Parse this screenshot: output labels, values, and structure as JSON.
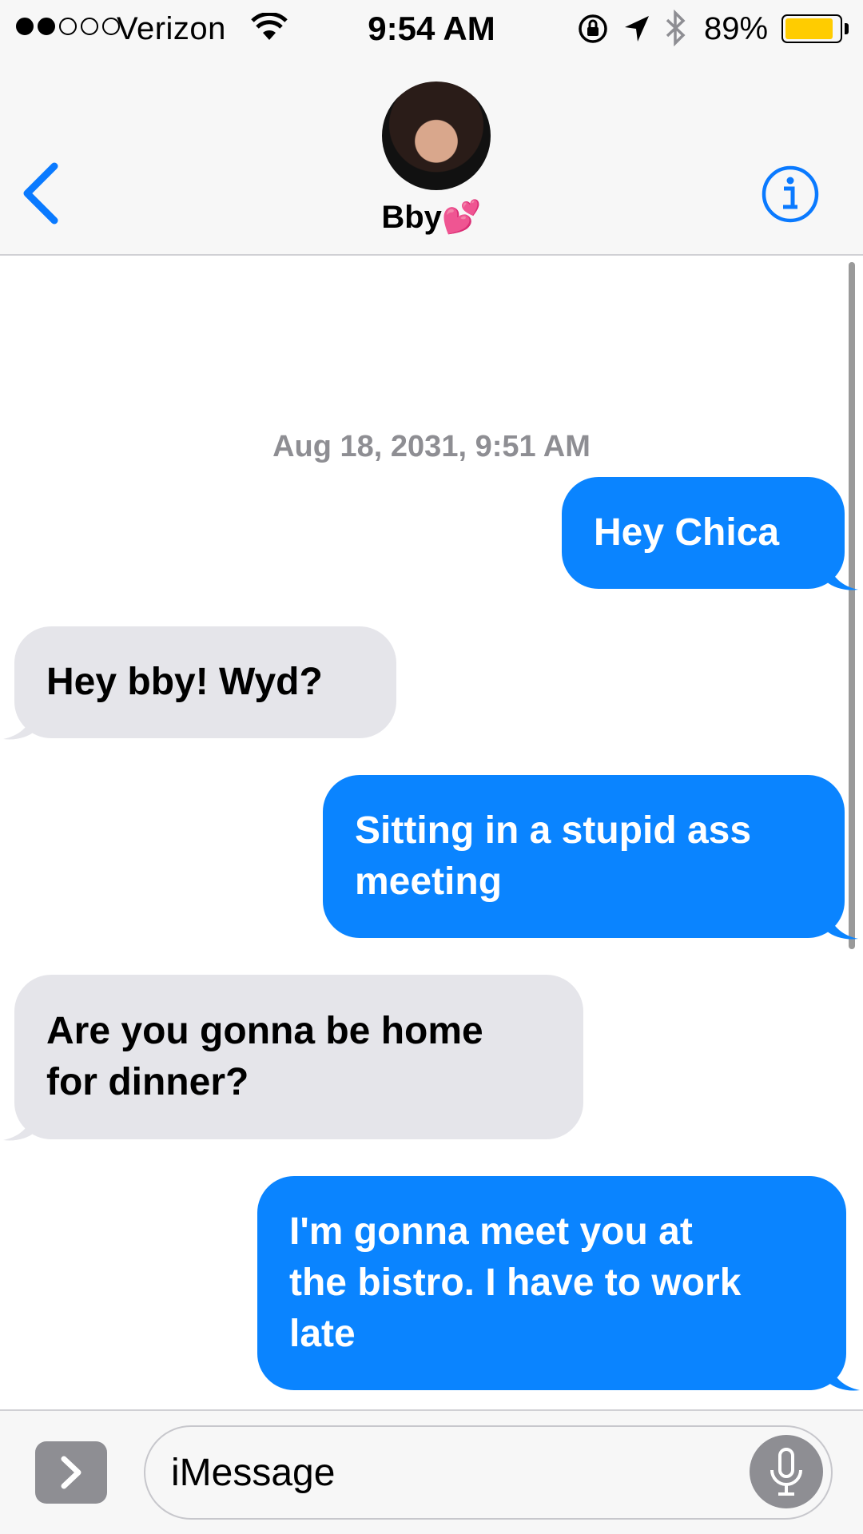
{
  "status_bar": {
    "carrier": "Verizon",
    "time": "9:54 AM",
    "battery_percent": "89%",
    "battery_level": 0.89,
    "signal_bars_filled": 2,
    "signal_bars_total": 5
  },
  "nav": {
    "contact_name": "Bby💕",
    "back_icon": "chevron-left-icon",
    "info_icon": "info-icon"
  },
  "conversation": {
    "timestamp": "Aug 18, 2031, 9:51 AM",
    "messages": [
      {
        "direction": "sent",
        "lines": [
          "Hey Chica"
        ]
      },
      {
        "direction": "received",
        "lines": [
          "Hey bby! Wyd?"
        ]
      },
      {
        "direction": "sent",
        "lines": [
          "Sitting in a stupid ass",
          "meeting"
        ]
      },
      {
        "direction": "received",
        "lines": [
          "Are you gonna be home",
          "for dinner?"
        ]
      },
      {
        "direction": "sent",
        "lines": [
          "I'm gonna meet you at",
          "the bistro. I have to work",
          "late"
        ]
      }
    ]
  },
  "input": {
    "placeholder": "iMessage",
    "apps_icon": "chevron-right-icon",
    "mic_icon": "microphone-icon"
  },
  "colors": {
    "sent_bubble": "#0a84ff",
    "received_bubble": "#e5e5ea",
    "accent": "#0a7aff",
    "timestamp": "#8e8e93"
  }
}
